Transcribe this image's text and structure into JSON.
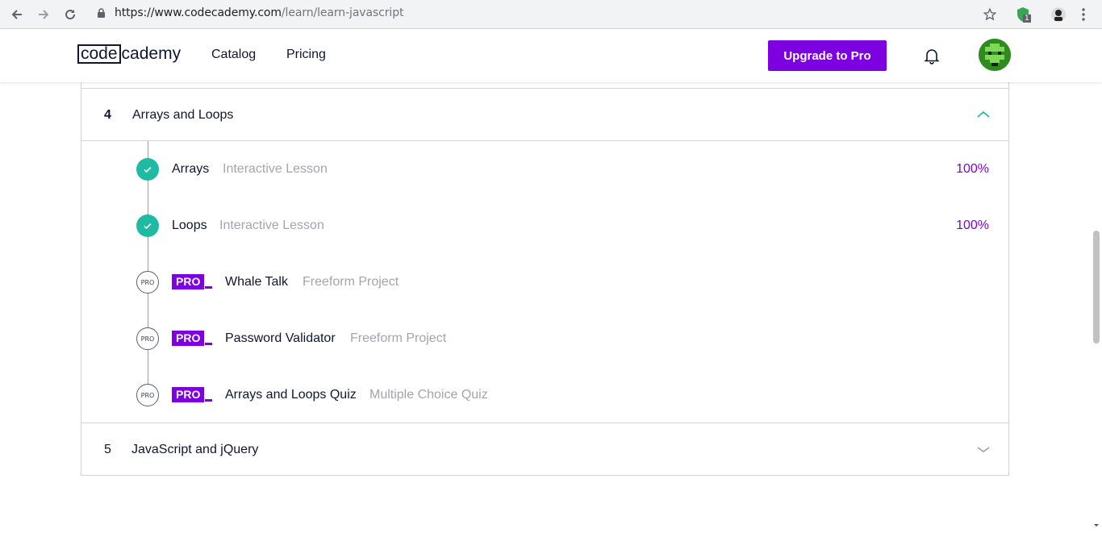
{
  "browser": {
    "url_host": "https://www.codecademy.com",
    "url_path": "/learn/learn-javascript",
    "extension_badge": "1"
  },
  "header": {
    "logo_box": "code",
    "logo_rest": "cademy",
    "nav": [
      "Catalog",
      "Pricing"
    ],
    "upgrade_label": "Upgrade to Pro"
  },
  "modules": [
    {
      "number": "4",
      "title": "Arrays and Loops",
      "expanded": true,
      "lessons": [
        {
          "title": "Arrays",
          "type": "Interactive Lesson",
          "progress": "100%",
          "status": "complete"
        },
        {
          "title": "Loops",
          "type": "Interactive Lesson",
          "progress": "100%",
          "status": "complete"
        },
        {
          "title": "Whale Talk",
          "type": "Freeform Project",
          "status": "pro"
        },
        {
          "title": "Password Validator",
          "type": "Freeform Project",
          "status": "pro"
        },
        {
          "title": "Arrays and Loops Quiz",
          "type": "Multiple Choice Quiz",
          "status": "pro"
        }
      ]
    },
    {
      "number": "5",
      "title": "JavaScript and jQuery",
      "expanded": false
    }
  ],
  "pro_badge": "PRO",
  "pro_circle": "PRO",
  "colors": {
    "brand_purple": "#7d00e0",
    "complete_green": "#1ebba2",
    "text_dark": "#10162f",
    "text_muted": "#a2a5ad"
  }
}
